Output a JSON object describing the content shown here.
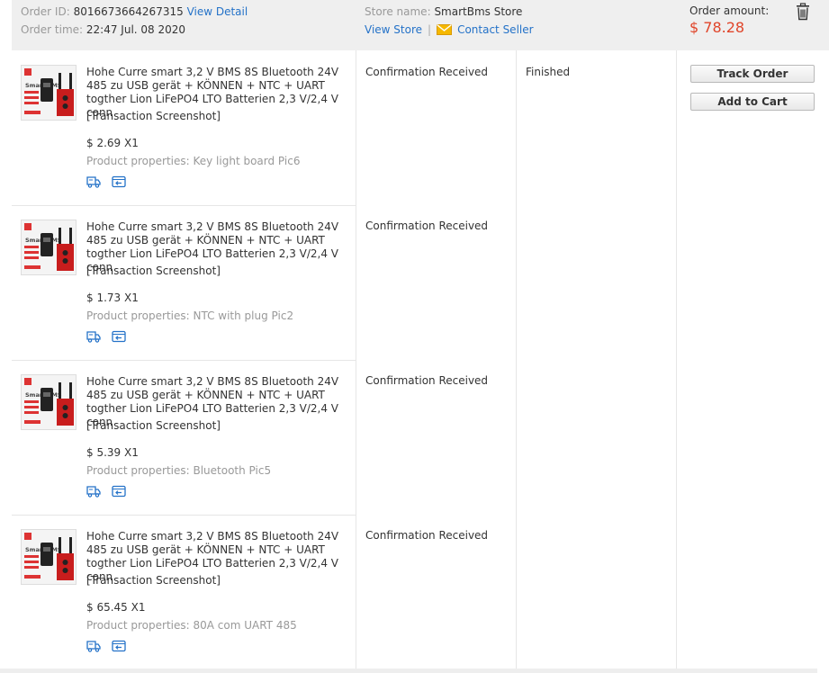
{
  "order": {
    "id_label": "Order ID:",
    "id_value": "8016673664267315",
    "view_detail": "View Detail",
    "time_label": "Order time:",
    "time_value": "22:47 Jul. 08 2020",
    "store_label": "Store name:",
    "store_value": "SmartBms Store",
    "view_store": "View Store",
    "separator": "|",
    "contact_seller": "Contact Seller",
    "amount_label": "Order amount:",
    "amount_value": "$ 78.28",
    "order_status": "Finished",
    "track_order": "Track Order",
    "add_to_cart": "Add to Cart",
    "colors": {
      "accent_link": "#2472c8",
      "price_red": "#e0452a",
      "mail_icon": "#f5b800"
    }
  },
  "items": [
    {
      "title": "Hohe Curre smart 3,2 V BMS 8S Bluetooth 24V 485 zu USB gerät + KÖNNEN + NTC + UART togther Lion LiFePO4 LTO Batterien 2,3 V/2,4 V conn",
      "snapshot": "[Transaction Screenshot]",
      "price": "$ 2.69 X1",
      "props_label": "Product properties:",
      "props_value": "Key light board Pic6",
      "status": "Confirmation Received"
    },
    {
      "title": "Hohe Curre smart 3,2 V BMS 8S Bluetooth 24V 485 zu USB gerät + KÖNNEN + NTC + UART togther Lion LiFePO4 LTO Batterien 2,3 V/2,4 V conn",
      "snapshot": "[Transaction Screenshot]",
      "price": "$ 1.73 X1",
      "props_label": "Product properties:",
      "props_value": "NTC with plug Pic2",
      "status": "Confirmation Received"
    },
    {
      "title": "Hohe Curre smart 3,2 V BMS 8S Bluetooth 24V 485 zu USB gerät + KÖNNEN + NTC + UART togther Lion LiFePO4 LTO Batterien 2,3 V/2,4 V conn",
      "snapshot": "[Transaction Screenshot]",
      "price": "$ 5.39 X1",
      "props_label": "Product properties:",
      "props_value": "Bluetooth Pic5",
      "status": "Confirmation Received"
    },
    {
      "title": "Hohe Curre smart 3,2 V BMS 8S Bluetooth 24V 485 zu USB gerät + KÖNNEN + NTC + UART togther Lion LiFePO4 LTO Batterien 2,3 V/2,4 V conn",
      "snapshot": "[Transaction Screenshot]",
      "price": "$ 65.45 X1",
      "props_label": "Product properties:",
      "props_value": "80A com UART 485",
      "status": "Confirmation Received"
    }
  ],
  "thumbnail_text": "Smart BMS",
  "icons": {
    "delete": "trash-icon",
    "contact": "mail-icon",
    "shipping": "truck-icon",
    "refund": "refund-icon"
  }
}
